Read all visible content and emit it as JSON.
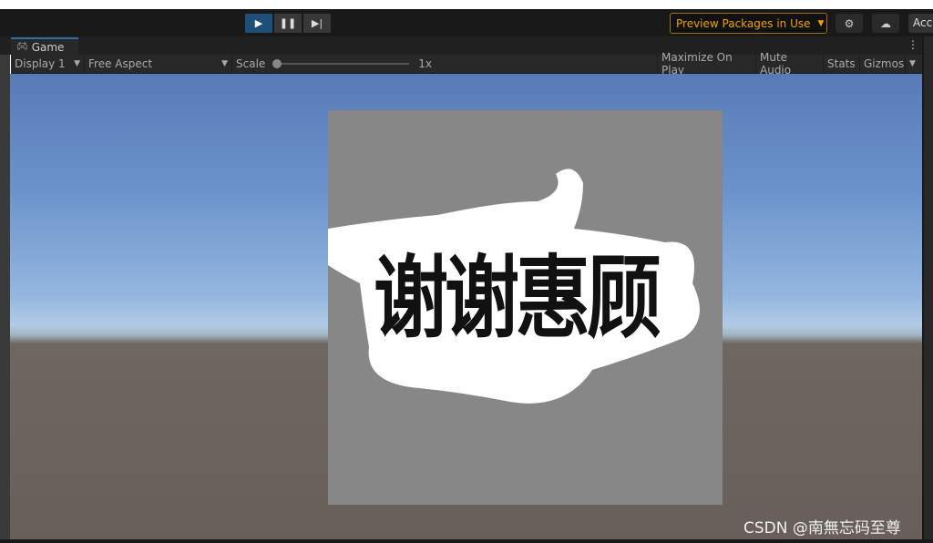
{
  "toolbar": {
    "play": "▶",
    "pause": "❚❚",
    "step": "▶|",
    "preview_packages": "Preview Packages in Use",
    "account": "Acc"
  },
  "tab": {
    "label": "Game"
  },
  "game_toolbar": {
    "display": "Display 1",
    "aspect": "Free Aspect",
    "scale_label": "Scale",
    "scale_value": "1x",
    "maximize": "Maximize On Play",
    "mute": "Mute Audio",
    "stats": "Stats",
    "gizmos": "Gizmos"
  },
  "scene": {
    "text": "谢谢惠顾"
  },
  "watermark": "CSDN @南無忘码至尊",
  "colors": {
    "accent": "#1d4f7a",
    "preview": "#f0a000"
  }
}
